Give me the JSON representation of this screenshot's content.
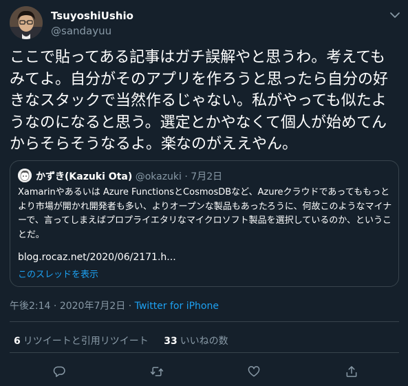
{
  "user": {
    "name": "TsuyoshiUshio",
    "handle": "@sandayuu"
  },
  "tweet": {
    "text": "ここで貼ってある記事はガチ誤解やと思うわ。考えてもみてよ。自分がそのアプリを作ろうと思ったら自分の好きなスタックで当然作るじゃない。私がやっても似たようなのになると思う。選定とかやなくて個人が始めてんからそらそうなるよ。楽なのがええやん。"
  },
  "quote": {
    "name": "かずき(Kazuki Ota)",
    "handle": "@okazuki",
    "separator": "·",
    "date": "7月2日",
    "text": "Xamarinやあるいは Azure FunctionsとCosmosDBなど、Azureクラウドであってももっとより市場が開かれ開発者も多い、よりオープンな製品もあったろうに、何故このようなマイナーで、言ってしまえばプロプライエタリなマイクロソフト製品を選択しているのか、ということだ。",
    "link": "blog.rocaz.net/2020/06/2171.h...",
    "show_thread": "このスレッドを表示"
  },
  "meta": {
    "time": "午後2:14",
    "separator": " · ",
    "date": "2020年7月2日",
    "separator2": " · ",
    "source": "Twitter for iPhone"
  },
  "stats": {
    "retweets_count": "6",
    "retweets_label": "リツイートと引用リツイート",
    "likes_count": "33",
    "likes_label": "いいねの数"
  },
  "colors": {
    "background": "#15202b",
    "accent": "#1da1f2",
    "secondary_text": "#8899a6",
    "border": "#38444d"
  },
  "icons": {
    "more": "chevron-down-icon",
    "reply": "reply-icon",
    "retweet": "retweet-icon",
    "like": "heart-icon",
    "share": "share-icon"
  }
}
